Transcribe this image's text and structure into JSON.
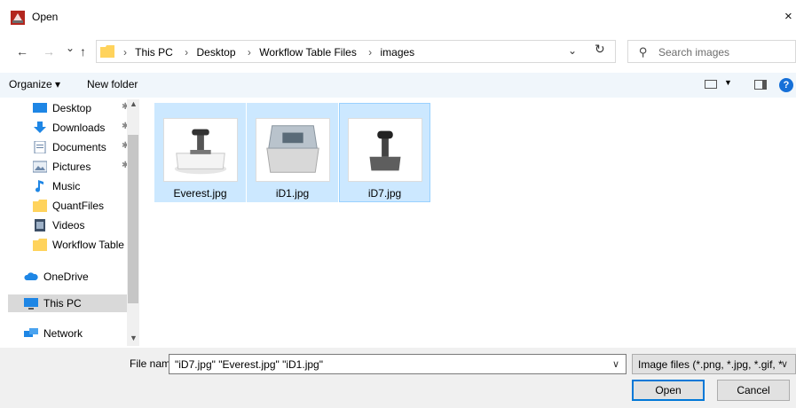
{
  "window": {
    "title": "Open",
    "close_glyph": "×"
  },
  "navigation": {
    "back_glyph": "←",
    "forward_glyph": "→",
    "recent_glyph": "⌄",
    "up_glyph": "↑",
    "breadcrumbs": [
      "This PC",
      "Desktop",
      "Workflow Table Files",
      "images"
    ],
    "separator": "›",
    "dropdown_glyph": "⌄",
    "refresh_glyph": "↻",
    "search_placeholder": "Search images",
    "search_glyph": "⚲"
  },
  "toolbar": {
    "organize_label": "Organize ▾",
    "new_folder_label": "New folder",
    "help_glyph": "?",
    "view_caret": "▼"
  },
  "sidebar": {
    "items": [
      {
        "label": "Desktop",
        "icon": "desktop-icon",
        "pinned": true
      },
      {
        "label": "Downloads",
        "icon": "downloads-icon",
        "pinned": true
      },
      {
        "label": "Documents",
        "icon": "documents-icon",
        "pinned": true
      },
      {
        "label": "Pictures",
        "icon": "pictures-icon",
        "pinned": true
      },
      {
        "label": "Music",
        "icon": "music-icon",
        "pinned": false
      },
      {
        "label": "QuantFiles",
        "icon": "folder-icon",
        "pinned": false
      },
      {
        "label": "Videos",
        "icon": "videos-icon",
        "pinned": false
      },
      {
        "label": "Workflow Table I",
        "icon": "folder-icon",
        "pinned": false
      },
      {
        "label": "OneDrive",
        "icon": "onedrive-icon",
        "pinned": false
      },
      {
        "label": "This PC",
        "icon": "this-pc-icon",
        "pinned": false,
        "selected": true
      },
      {
        "label": "Network",
        "icon": "network-icon",
        "pinned": false
      }
    ],
    "pin_glyph": "✱",
    "scroll_up_glyph": "▲",
    "scroll_down_glyph": "▼"
  },
  "files": [
    {
      "name": "Everest.jpg",
      "icon": "image-thumbnail",
      "selected": true
    },
    {
      "name": "iD1.jpg",
      "icon": "image-thumbnail",
      "selected": true
    },
    {
      "name": "iD7.jpg",
      "icon": "image-thumbnail",
      "selected": true,
      "focused": true
    }
  ],
  "footer": {
    "file_name_label": "File name:",
    "file_name_value": "\"iD7.jpg\" \"Everest.jpg\" \"iD1.jpg\"",
    "dropdown_glyph": "∨",
    "file_type_value": "Image files (*.png, *.jpg, *.gif, *",
    "open_label": "Open",
    "cancel_label": "Cancel"
  },
  "colors": {
    "selection": "#cce8ff",
    "selection_border": "#99d1ff",
    "toolbar_bg": "#f0f6fb",
    "footer_bg": "#f0f0f0",
    "accent": "#0078d7"
  }
}
